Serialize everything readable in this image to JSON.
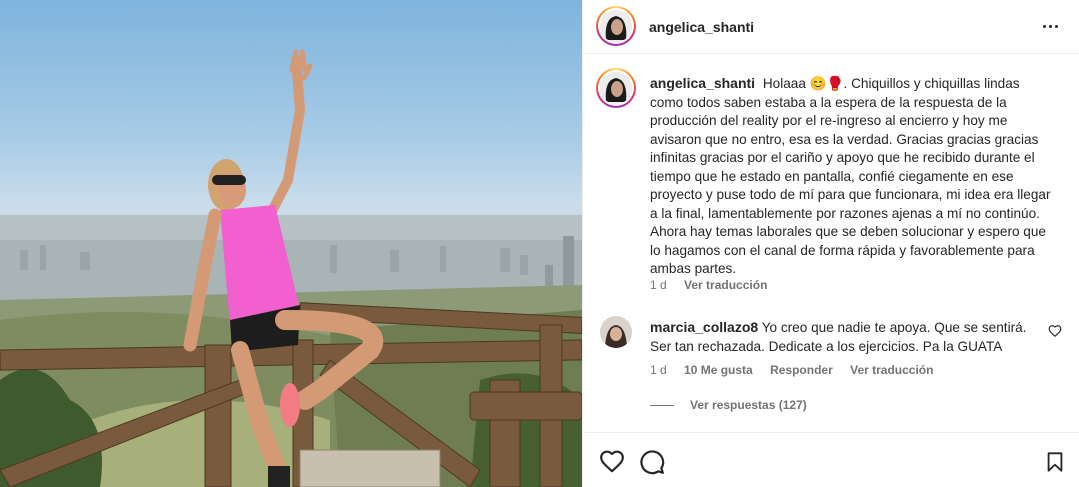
{
  "post": {
    "username": "angelica_shanti",
    "more_icon": "more-horizontal-icon"
  },
  "caption": {
    "username": "angelica_shanti",
    "text": "Holaaa 😊🥊. Chiquillos y chiquillas lindas como todos saben estaba a la espera de la respuesta de la producción del reality por el re-ingreso al encierro y hoy me avisaron que no entro, esa es la verdad. Gracias gracias gracias infinitas gracias por el cariño y apoyo que he recibido durante el tiempo que he estado en pantalla, confié ciegamente en ese proyecto y puse todo de mí para que funcionara, mi idea era llegar a la final, lamentablemente por razones ajenas a mí no continúo. Ahora hay temas laborales que se deben solucionar y espero que lo hagamos con el canal de forma rápida y favorablemente para ambas partes.",
    "time": "1 d",
    "see_translation": "Ver traducción"
  },
  "comment": {
    "username": "marcia_collazo8",
    "text": "Yo creo que nadie te apoya. Que se sentirá. Ser tan rechazada. Dedicate a los ejercicios. Pa la GUATA",
    "time": "1 d",
    "likes": "10 Me gusta",
    "reply": "Responder",
    "see_translation": "Ver traducción",
    "view_replies": "Ver respuestas (127)"
  },
  "actions": {
    "like_icon": "heart-icon",
    "comment_icon": "comment-icon",
    "save_icon": "bookmark-icon"
  }
}
